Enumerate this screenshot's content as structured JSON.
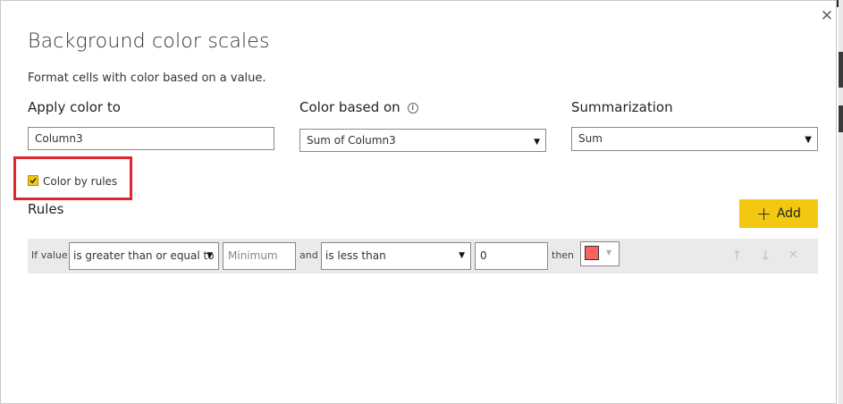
{
  "dialog": {
    "title": "Background color scales",
    "description": "Format cells with color based on a value.",
    "close_glyph": "✕"
  },
  "apply_color_to": {
    "label": "Apply color to",
    "value": "Column3"
  },
  "color_based_on": {
    "label": "Color based on",
    "info_glyph": "i",
    "selected": "Sum of Column3"
  },
  "summarization": {
    "label": "Summarization",
    "selected": "Sum"
  },
  "color_by_rules": {
    "label": "Color by rules",
    "checked": true,
    "checkbox_color": "#F2C811",
    "highlight_color": "#E0252D"
  },
  "rules": {
    "title": "Rules",
    "add_label": "Add",
    "add_glyph": "+",
    "add_color": "#F2C811",
    "row": {
      "if_value_label": "If value",
      "operator1": "is greater than or equal to",
      "min_placeholder": "Minimum",
      "and_label": "and",
      "operator2": "is less than",
      "max_value": "0",
      "then_label": "then",
      "swatch_color": "#FD625E"
    },
    "actions": {
      "up_glyph": "↑",
      "down_glyph": "↓",
      "delete_glyph": "✕"
    }
  }
}
